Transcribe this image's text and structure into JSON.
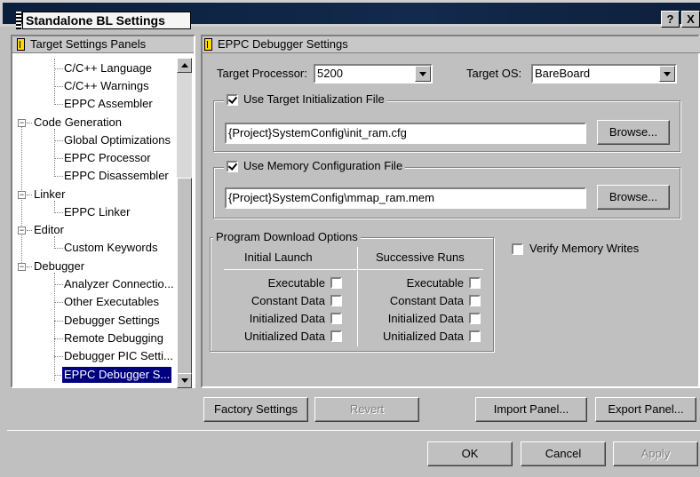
{
  "window": {
    "title": "Standalone BL Settings",
    "help_label": "?",
    "close_label": "X"
  },
  "tree": {
    "header": "Target Settings Panels",
    "items": [
      {
        "label": "C/C++ Language"
      },
      {
        "label": "C/C++ Warnings"
      },
      {
        "label": "EPPC Assembler"
      },
      {
        "label": "Code Generation",
        "toggle": "−"
      },
      {
        "label": "Global Optimizations"
      },
      {
        "label": "EPPC Processor"
      },
      {
        "label": "EPPC Disassembler"
      },
      {
        "label": "Linker",
        "toggle": "−"
      },
      {
        "label": "EPPC Linker"
      },
      {
        "label": "Editor",
        "toggle": "−"
      },
      {
        "label": "Custom Keywords"
      },
      {
        "label": "Debugger",
        "toggle": "−"
      },
      {
        "label": "Analyzer Connectio..."
      },
      {
        "label": "Other Executables"
      },
      {
        "label": "Debugger Settings"
      },
      {
        "label": "Remote Debugging"
      },
      {
        "label": "Debugger PIC Setti..."
      },
      {
        "label": "EPPC Debugger S..."
      }
    ]
  },
  "panel": {
    "header": "EPPC Debugger Settings",
    "target_processor_label": "Target Processor:",
    "target_processor_value": "5200",
    "target_os_label": "Target OS:",
    "target_os_value": "BareBoard",
    "init_file_label": "Use Target Initialization File",
    "init_file_checked": true,
    "init_file_path": "{Project}SystemConfig\\init_ram.cfg",
    "browse_label": "Browse...",
    "mem_config_label": "Use Memory Configuration File",
    "mem_config_checked": true,
    "mem_config_path": "{Project}SystemConfig\\mmap_ram.mem",
    "download_options_title": "Program Download Options",
    "col_initial": "Initial Launch",
    "col_successive": "Successive Runs",
    "rows": [
      "Executable",
      "Constant Data",
      "Initialized Data",
      "Unitialized Data"
    ],
    "verify_label": "Verify Memory Writes"
  },
  "buttons": {
    "factory": "Factory Settings",
    "revert": "Revert",
    "import": "Import Panel...",
    "export": "Export Panel...",
    "ok": "OK",
    "cancel": "Cancel",
    "apply": "Apply"
  }
}
